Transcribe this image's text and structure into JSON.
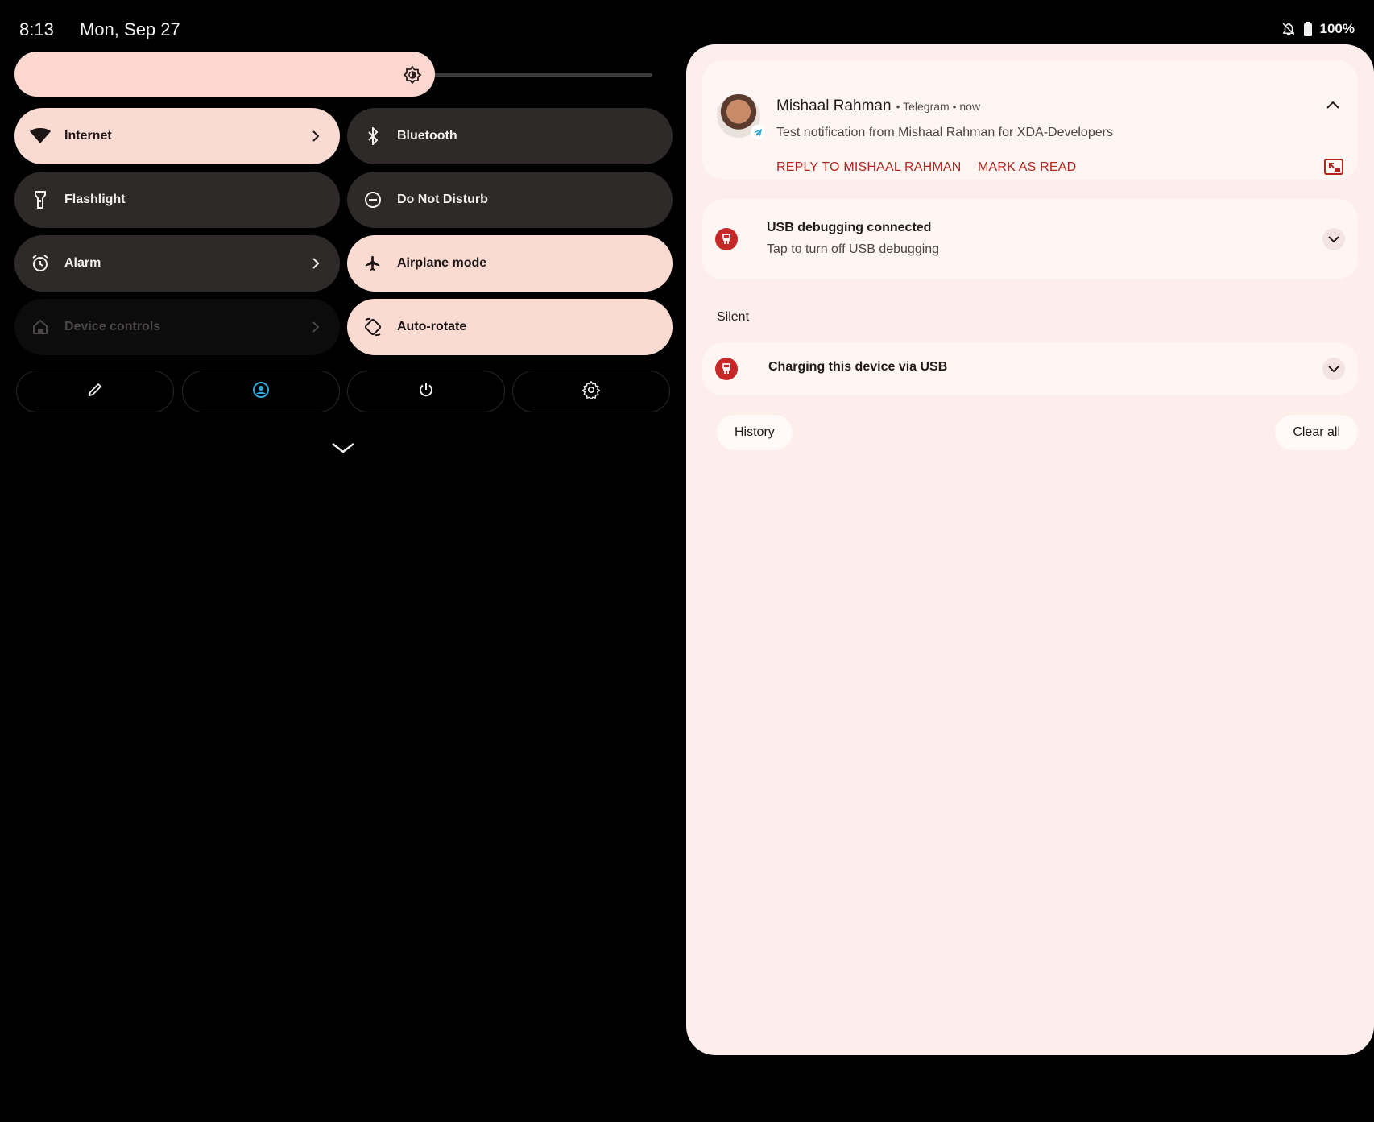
{
  "status_bar": {
    "time": "8:13",
    "date": "Mon, Sep 27",
    "battery": "100%",
    "icons": [
      "bell-off-icon",
      "battery-icon"
    ]
  },
  "brightness": {
    "level": 0.62,
    "icon": "brightness-icon"
  },
  "tiles": [
    {
      "label": "Internet",
      "icon": "wifi-icon",
      "state": "on",
      "has_chevron": true
    },
    {
      "label": "Bluetooth",
      "icon": "bluetooth-icon",
      "state": "off",
      "has_chevron": false
    },
    {
      "label": "Flashlight",
      "icon": "flashlight-icon",
      "state": "off",
      "has_chevron": false
    },
    {
      "label": "Do Not Disturb",
      "icon": "do-not-disturb-icon",
      "state": "off",
      "has_chevron": false
    },
    {
      "label": "Alarm",
      "icon": "alarm-icon",
      "state": "off",
      "has_chevron": true
    },
    {
      "label": "Airplane mode",
      "icon": "airplane-icon",
      "state": "on",
      "has_chevron": false
    },
    {
      "label": "Device controls",
      "icon": "home-icon",
      "state": "disabled",
      "has_chevron": true
    },
    {
      "label": "Auto-rotate",
      "icon": "auto-rotate-icon",
      "state": "on",
      "has_chevron": false
    }
  ],
  "footer_buttons": [
    "edit-icon",
    "user-icon",
    "power-icon",
    "settings-icon"
  ],
  "colors": {
    "tile_on": "#fbdad2",
    "tile_off": "#2d2a29",
    "panel_bg": "#fdeeec",
    "accent_red": "#b3261e",
    "user_icon": "#2fa8d8"
  },
  "notifications": {
    "telegram": {
      "sender": "Mishaal Rahman",
      "meta": "• Telegram • now",
      "body": "Test notification from Mishaal Rahman for XDA-Developers",
      "actions": [
        "REPLY TO MISHAAL RAHMAN",
        "MARK AS READ"
      ]
    },
    "usb_debugging": {
      "title": "USB debugging connected",
      "subtitle": "Tap to turn off USB debugging"
    },
    "silent_section": "Silent",
    "charging": {
      "title": "Charging this device via USB"
    },
    "history_button": "History",
    "clear_all_button": "Clear all"
  }
}
